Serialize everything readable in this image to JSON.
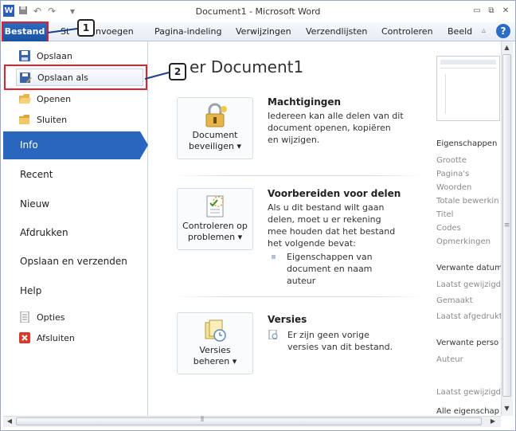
{
  "window": {
    "title": "Document1 - Microsoft Word"
  },
  "tabs": [
    "Bestand",
    "Start",
    "Invoegen",
    "Pagina-indeling",
    "Verwijzingen",
    "Verzendlijsten",
    "Controleren",
    "Beeld"
  ],
  "tab_visible": {
    "start_fragment": "St",
    "insert_fragment": "nvoegen"
  },
  "left_menu": {
    "save": "Opslaan",
    "save_as": "Opslaan als",
    "open": "Openen",
    "close": "Sluiten",
    "info": "Info",
    "recent": "Recent",
    "new": "Nieuw",
    "print": "Afdrukken",
    "save_send": "Opslaan en verzenden",
    "help": "Help",
    "options": "Opties",
    "exit": "Afsluiten"
  },
  "main": {
    "doc_title": "er Document1",
    "protect": {
      "button": [
        "Document",
        "beveiligen ▾"
      ],
      "heading": "Machtigingen",
      "text": [
        "Iedereen kan alle delen van dit",
        "document openen, kopiëren",
        "en wijzigen."
      ]
    },
    "check": {
      "button": [
        "Controleren op",
        "problemen ▾"
      ],
      "heading": "Voorbereiden voor delen",
      "text": [
        "Als u dit bestand wilt gaan",
        "delen, moet u er rekening",
        "mee houden dat het bestand",
        "het volgende bevat:"
      ],
      "bullet": [
        "Eigenschappen van",
        "document en naam",
        "auteur"
      ]
    },
    "versions": {
      "button": [
        "Versies",
        "beheren ▾"
      ],
      "heading": "Versies",
      "text": [
        "Er zijn geen vorige",
        "versies van dit bestand."
      ]
    }
  },
  "right_panel": {
    "properties_heading": "Eigenschappen",
    "props": [
      "Grootte",
      "Pagina's",
      "Woorden",
      "Totale bewerkin",
      "Titel",
      "Codes",
      "Opmerkingen"
    ],
    "related_dates_heading": "Verwante datum",
    "dates": [
      "Laatst gewijzigd",
      "Gemaakt",
      "Laatst afgedrukt"
    ],
    "related_people_heading": "Verwante perso",
    "people": [
      "Auteur"
    ],
    "last_modified_by": "Laatst gewijzigd",
    "all_properties": "Alle eigenschap"
  },
  "callouts": [
    "1",
    "2"
  ],
  "colors": {
    "file_tab": "#1a52a3",
    "info_tab": "#2a66bd",
    "callout_border": "#e0222e"
  }
}
